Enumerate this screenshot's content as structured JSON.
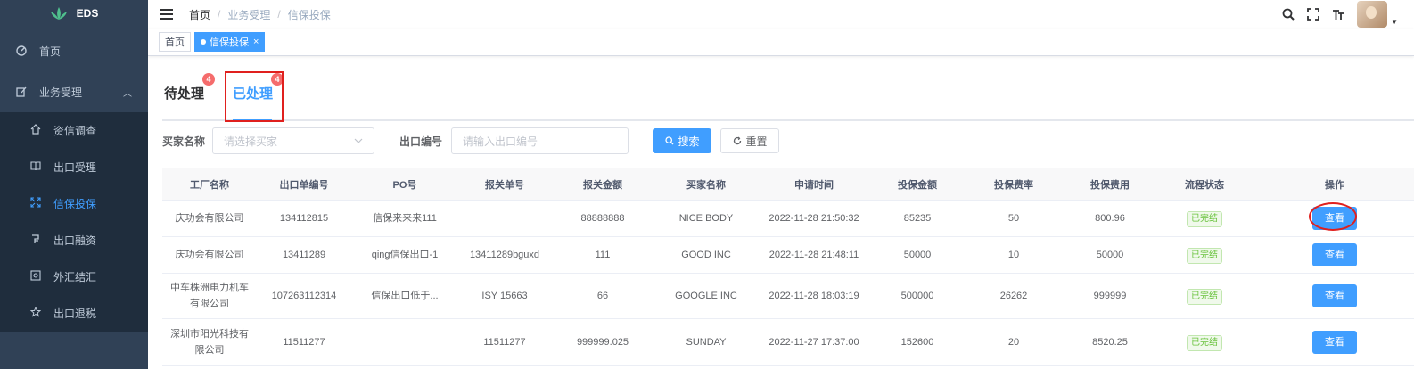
{
  "app": {
    "logo_text": "EDS"
  },
  "sidebar": {
    "home": "首页",
    "business": "业务受理",
    "sub_items": [
      {
        "label": "资信调查",
        "icon": "home-icon"
      },
      {
        "label": "出口受理",
        "icon": "book-icon"
      },
      {
        "label": "信保投保",
        "icon": "expand-icon",
        "active": true
      },
      {
        "label": "出口融资",
        "icon": "finance-icon"
      },
      {
        "label": "外汇结汇",
        "icon": "exchange-icon"
      },
      {
        "label": "出口退税",
        "icon": "star-icon"
      }
    ]
  },
  "breadcrumb": {
    "home": "首页",
    "level1": "业务受理",
    "level2": "信保投保"
  },
  "tags": {
    "home": "首页",
    "current": "信保投保"
  },
  "tabs": {
    "pending": {
      "label": "待处理",
      "badge": "4"
    },
    "done": {
      "label": "已处理",
      "badge": "4"
    }
  },
  "filters": {
    "buyer_label": "买家名称",
    "buyer_placeholder": "请选择买家",
    "export_label": "出口编号",
    "export_placeholder": "请输入出口编号",
    "search_label": "搜索",
    "reset_label": "重置"
  },
  "table": {
    "headers": [
      "工厂名称",
      "出口单编号",
      "PO号",
      "报关单号",
      "报关金额",
      "买家名称",
      "申请时间",
      "投保金额",
      "投保费率",
      "投保费用",
      "流程状态",
      "操作"
    ],
    "rows": [
      {
        "factory": "庆功会有限公司",
        "export_no": "134112815",
        "po": "信保来来来111",
        "customs_no": "",
        "customs_amount": "88888888",
        "buyer": "NICE BODY",
        "time": "2022-11-28 21:50:32",
        "insured_amount": "85235",
        "rate": "50",
        "fee": "800.96",
        "status": "已完结",
        "action": "查看"
      },
      {
        "factory": "庆功会有限公司",
        "export_no": "13411289",
        "po": "qing信保出口-1",
        "customs_no": "13411289bguxd",
        "customs_amount": "111",
        "buyer": "GOOD INC",
        "time": "2022-11-28 21:48:11",
        "insured_amount": "50000",
        "rate": "10",
        "fee": "50000",
        "status": "已完结",
        "action": "查看"
      },
      {
        "factory": "中车株洲电力机车有限公司",
        "export_no": "107263112314",
        "po": "信保出口低于...",
        "customs_no": "ISY 15663",
        "customs_amount": "66",
        "buyer": "GOOGLE INC",
        "time": "2022-11-28 18:03:19",
        "insured_amount": "500000",
        "rate": "26262",
        "fee": "999999",
        "status": "已完结",
        "action": "查看"
      },
      {
        "factory": "深圳市阳光科技有限公司",
        "export_no": "11511277",
        "po": "",
        "customs_no": "11511277",
        "customs_amount": "999999.025",
        "buyer": "SUNDAY",
        "time": "2022-11-27 17:37:00",
        "insured_amount": "152600",
        "rate": "20",
        "fee": "8520.25",
        "status": "已完结",
        "action": "查看"
      }
    ]
  }
}
